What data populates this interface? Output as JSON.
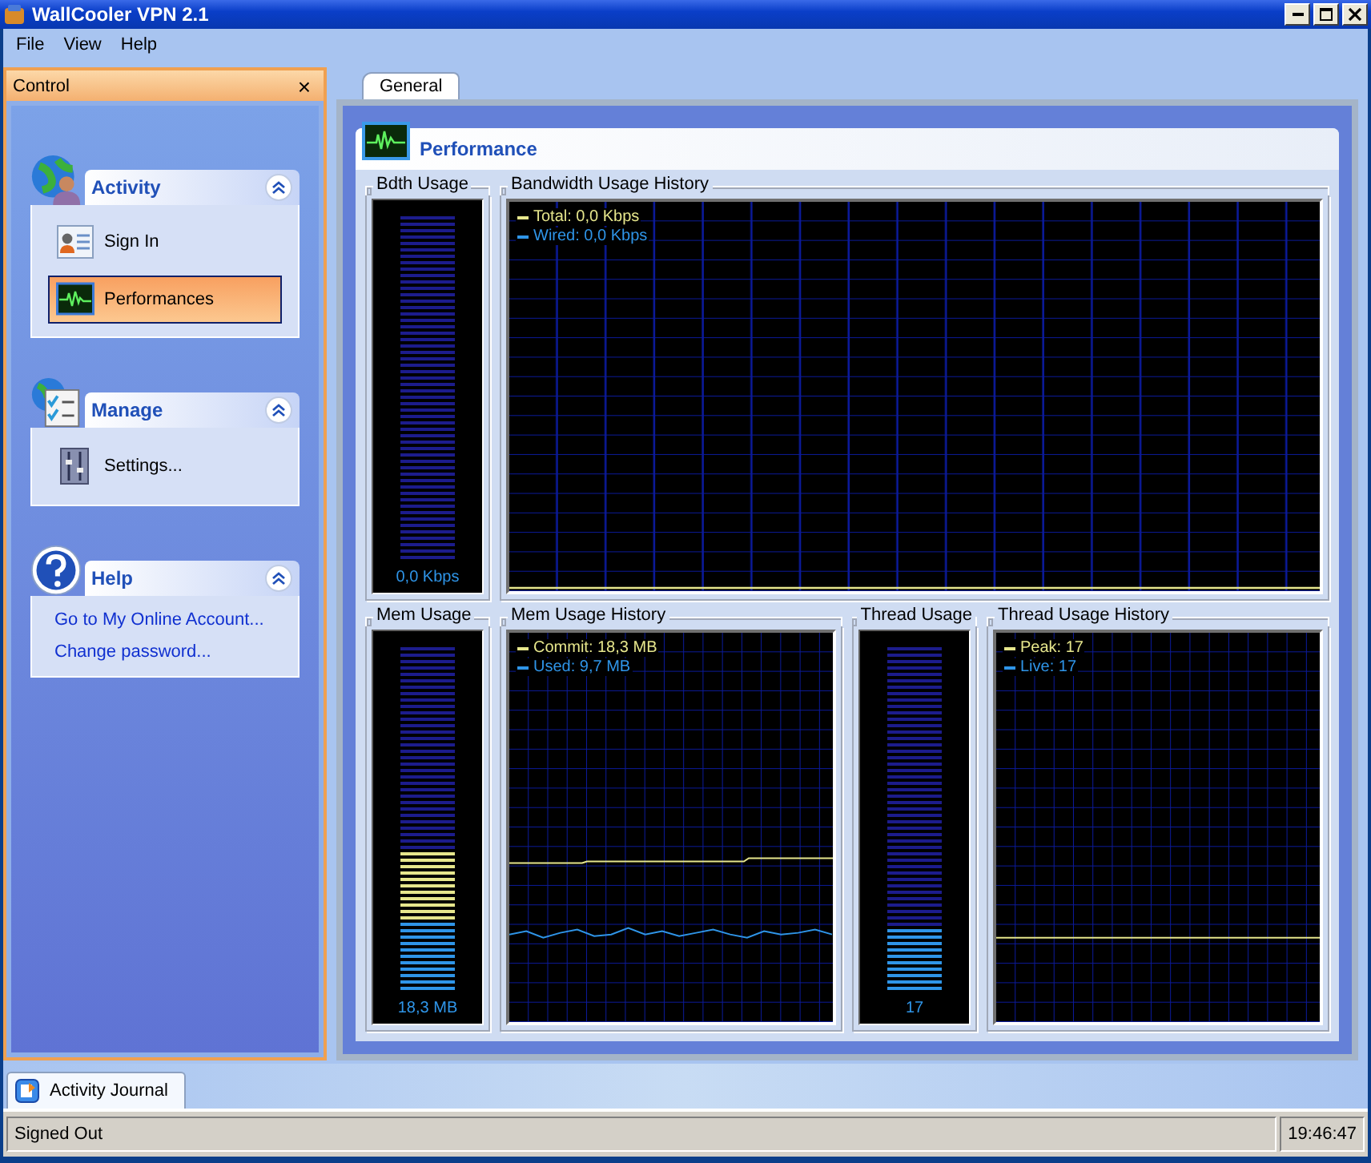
{
  "window": {
    "title": "WallCooler VPN 2.1"
  },
  "menu": [
    "File",
    "View",
    "Help"
  ],
  "control_panel": {
    "title": "Control",
    "close": "×",
    "groups": [
      {
        "kind": "activity",
        "title": "Activity",
        "items": [
          {
            "kind": "task",
            "label": "Sign In",
            "selected": false
          },
          {
            "kind": "task",
            "label": "Performances",
            "selected": true
          }
        ]
      },
      {
        "kind": "manage",
        "title": "Manage",
        "items": [
          {
            "kind": "task",
            "label": "Settings...",
            "selected": false
          }
        ]
      },
      {
        "kind": "help",
        "title": "Help",
        "items": [
          {
            "kind": "link",
            "label": "Go to My Online Account...",
            "selected": false
          },
          {
            "kind": "link",
            "label": "Change password...",
            "selected": false
          }
        ]
      }
    ]
  },
  "tabs": [
    {
      "label": "General",
      "selected": true
    }
  ],
  "performance": {
    "title": "Performance",
    "rows": [
      [
        {
          "kind": "gauge",
          "title": "Bdth Usage",
          "reading": "0,0 Kbps"
        },
        {
          "kind": "history",
          "title": "Bandwidth Usage History",
          "legend": [
            {
              "label": "Total: 0,0 Kbps",
              "color": "#e6e68c"
            },
            {
              "label": "Wired: 0,0 Kbps",
              "color": "#2f95e8"
            }
          ]
        }
      ],
      [
        {
          "kind": "gauge",
          "title": "Mem Usage",
          "reading": "18,3 MB",
          "bars": [
            {
              "kind": "commit",
              "level": 0.4
            },
            {
              "kind": "used",
              "level": 0.2
            }
          ]
        },
        {
          "kind": "history",
          "title": "Mem Usage History",
          "legend": [
            {
              "label": "Commit: 18,3 MB",
              "color": "#e6e68c"
            },
            {
              "label": "Used: 9,7 MB",
              "color": "#2f95e8"
            }
          ]
        },
        {
          "kind": "gauge",
          "title": "Thread Usage",
          "reading": "17",
          "bars": [
            {
              "kind": "live",
              "level": 0.18
            }
          ]
        },
        {
          "kind": "history",
          "title": "Thread Usage History",
          "legend": [
            {
              "label": "Peak: 17",
              "color": "#e6e68c"
            },
            {
              "label": "Live: 17",
              "color": "#2f95e8"
            }
          ]
        }
      ]
    ]
  },
  "bottom_tabs": [
    {
      "label": "Activity Journal",
      "selected": true
    }
  ],
  "status_bar": {
    "status": "Signed Out",
    "time": "19:46:47"
  }
}
